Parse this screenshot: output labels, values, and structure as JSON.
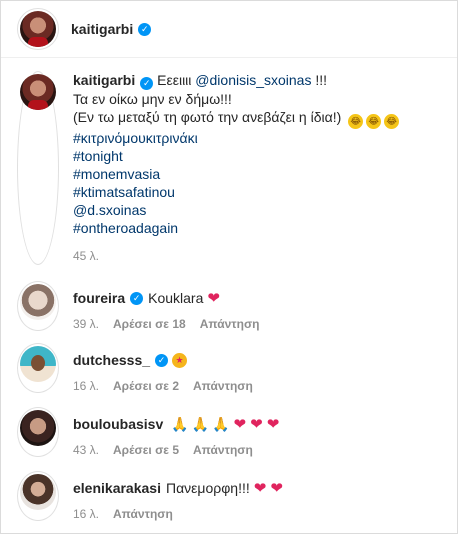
{
  "header": {
    "username": "kaitigarbi",
    "verified": true
  },
  "caption": {
    "username": "kaitigarbi",
    "text_line1": "Εεειιιι ",
    "mention1": "@dionisis_sxoinas",
    "text_line1_tail": " !!!",
    "text_line2": "Τα εν οίκω μην εν δήμω!!!",
    "text_line3": "(Εν τω μεταξύ τη φωτό την ανεβάζει η ίδια!)",
    "hashtags": [
      "#κιτρινόμουκιτρινάκι",
      "#tonight",
      "#monemvasia",
      "#ktimatsafatinou",
      "@d.sxoinas",
      "#ontheroadagain"
    ],
    "time": "45 λ."
  },
  "comments": [
    {
      "username": "foureira",
      "verified": true,
      "text": "Kouklara",
      "emojis": [
        "heart-icon"
      ],
      "time": "39 λ.",
      "likes": "Αρέσει σε 18",
      "reply": "Απάντηση"
    },
    {
      "username": "dutchesss_",
      "verified": true,
      "text": "",
      "emojis": [
        "star-eyes-icon"
      ],
      "time": "16 λ.",
      "likes": "Αρέσει σε 2",
      "reply": "Απάντηση"
    },
    {
      "username": "bouloubasisv",
      "verified": false,
      "text": "",
      "emojis": [
        "pray-icon",
        "pray-icon",
        "pray-icon",
        "heart-icon",
        "heart-icon",
        "heart-icon"
      ],
      "time": "43 λ.",
      "likes": "Αρέσει σε 5",
      "reply": "Απάντηση"
    },
    {
      "username": "elenikarakasi",
      "verified": false,
      "text": "Πανεμορφη!!!",
      "emojis": [
        "heart-icon",
        "heart-icon"
      ],
      "time": "16 λ.",
      "likes": "",
      "reply": "Απάντηση"
    }
  ],
  "colors": {
    "link": "#00376b",
    "verified": "#0095f6",
    "heart": "#e0245e",
    "meta": "#8e8e8e"
  }
}
